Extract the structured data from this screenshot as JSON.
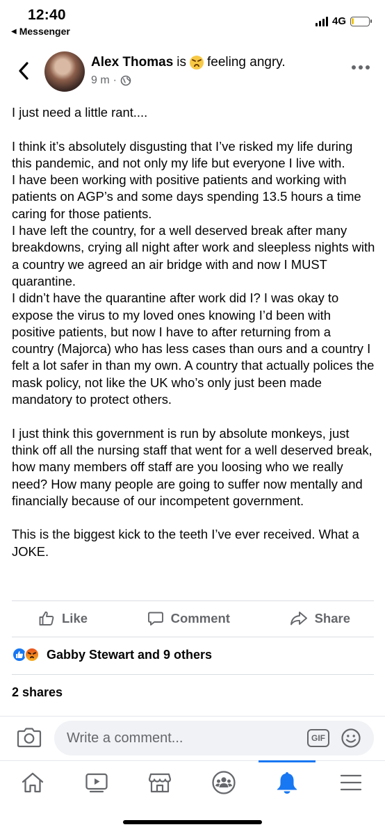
{
  "status_bar": {
    "time": "12:40",
    "back_app": "Messenger",
    "network": "4G",
    "battery_level": 0.15
  },
  "post": {
    "author": "Alex Thomas",
    "activity_prefix": "is",
    "activity_emoji": "angry-face",
    "activity_text": "feeling angry.",
    "timestamp": "9 m",
    "privacy_icon": "globe-icon",
    "paragraphs": [
      "I just need a little rant....",
      "I think it’s absolutely disgusting that I’ve risked my life during this pandemic, and not only my life but everyone I live with.\nI have been working with positive patients and working with patients on AGP’s and some days spending 13.5 hours a time caring for those patients.\nI have left the country, for a well deserved break after many breakdowns, crying all night after work and sleepless nights with a country we agreed an air bridge with and now I MUST quarantine.\nI didn’t have the quarantine after work did I? I was okay to expose the virus to my loved ones knowing I’d been with positive patients, but now I have to after returning from a country (Majorca) who has less cases than ours and a country I felt a lot safer in than my own. A country that actually polices the mask policy, not like the UK who’s only just been made mandatory to protect others.",
      "I just think this government is run by absolute monkeys, just think off all the nursing staff that went for a well deserved break, how many members off staff are you loosing who we really need? How many people are going to suffer now mentally and financially because of our incompetent government.",
      "This is the biggest kick to the teeth I’ve ever received. What a JOKE."
    ]
  },
  "actions": {
    "like": "Like",
    "comment": "Comment",
    "share": "Share"
  },
  "reactions": {
    "summary": "Gabby Stewart and 9 others",
    "types": [
      "like",
      "angry"
    ]
  },
  "shares": "2 shares",
  "composer": {
    "placeholder": "Write a comment...",
    "gif_label": "GIF"
  },
  "tabbar": {
    "items": [
      "home-icon",
      "watch-icon",
      "marketplace-icon",
      "groups-icon",
      "notifications-icon",
      "menu-icon"
    ],
    "active": "notifications-icon",
    "accent_color": "#1877f2"
  }
}
